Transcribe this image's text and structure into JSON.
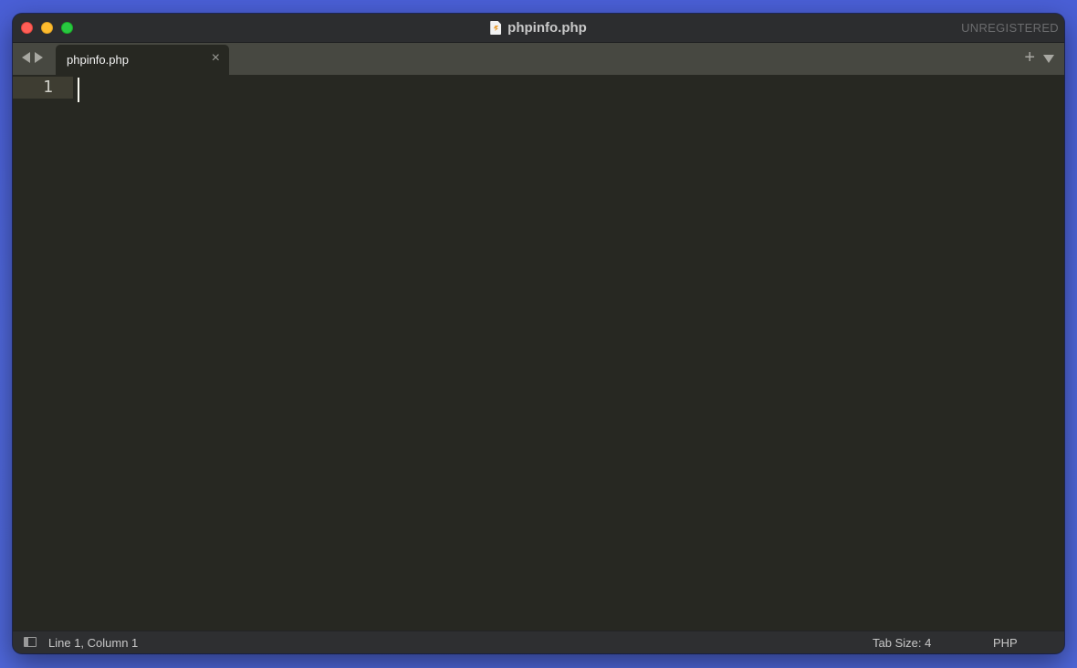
{
  "window": {
    "title": "phpinfo.php",
    "registration_status": "UNREGISTERED"
  },
  "tabs": [
    {
      "label": "phpinfo.php",
      "active": true,
      "close_glyph": "×"
    }
  ],
  "tabbar": {
    "new_tab_glyph": "+"
  },
  "editor": {
    "lines": [
      {
        "number": "1",
        "text": ""
      }
    ]
  },
  "statusbar": {
    "position": "Line 1, Column 1",
    "tab_size": "Tab Size: 4",
    "syntax": "PHP"
  },
  "icons": {
    "window_close": "close-button",
    "window_minimize": "minimize-button",
    "window_maximize": "maximize-button",
    "title_file": "php-file-icon",
    "nav_back": "arrow-left-icon",
    "nav_forward": "arrow-right-icon",
    "tab_menu": "chevron-down-icon",
    "sidebar": "sidebar-toggle-icon"
  },
  "colors": {
    "editor_background": "#272822",
    "tabbar_background": "#474841",
    "titlebar_background": "#2c2d2f",
    "current_line_highlight": "#3e3d32",
    "traffic_close": "#ff5f57",
    "traffic_minimize": "#febc2e",
    "traffic_maximize": "#28c840"
  }
}
